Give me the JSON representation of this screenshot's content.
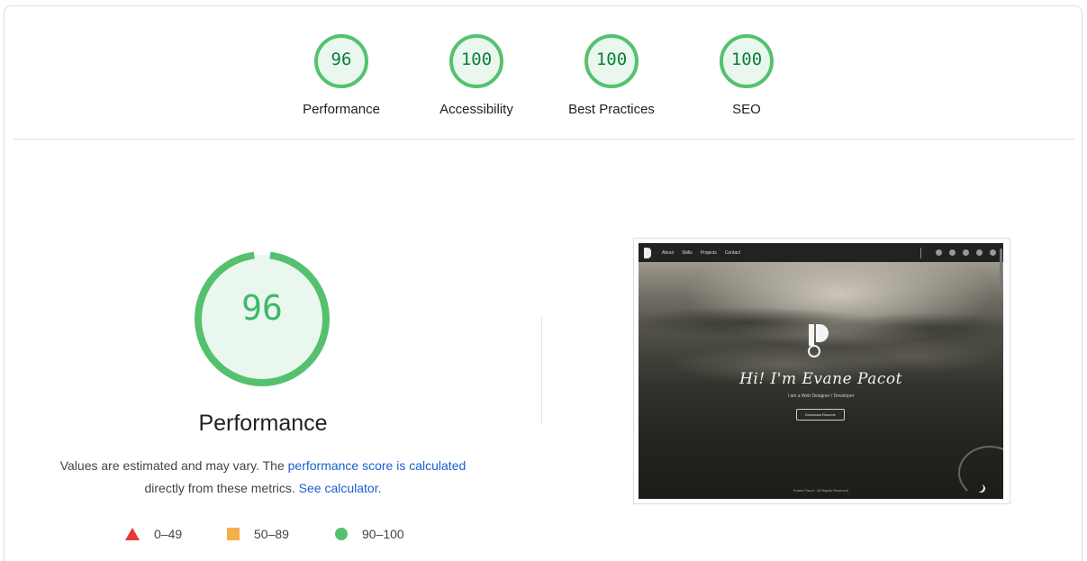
{
  "categories": [
    {
      "score": "96",
      "label": "Performance",
      "fraction": 0.96
    },
    {
      "score": "100",
      "label": "Accessibility",
      "fraction": 1.0
    },
    {
      "score": "100",
      "label": "Best Practices",
      "fraction": 1.0
    },
    {
      "score": "100",
      "label": "SEO",
      "fraction": 1.0
    }
  ],
  "main": {
    "score": "96",
    "fraction": 0.96,
    "title": "Performance",
    "desc_prefix": "Values are estimated and may vary. The ",
    "desc_link1": "performance score is calculated",
    "desc_middle": "directly from these metrics. ",
    "desc_link2": "See calculator",
    "desc_suffix": "."
  },
  "legend": [
    {
      "range": "0–49",
      "shape": "triangle",
      "color": "#e53935"
    },
    {
      "range": "50–89",
      "shape": "square",
      "color": "#f4b048"
    },
    {
      "range": "90–100",
      "shape": "circle",
      "color": "#55c16e"
    }
  ],
  "colors": {
    "pass": "#55c16e",
    "pass_fill": "#eaf7ee",
    "pass_text": "#0b7e3a",
    "link": "#1a5fd0"
  },
  "screenshot": {
    "nav": [
      "About",
      "Skills",
      "Projects",
      "Contact"
    ],
    "hero": "Hi! I'm Evane Pacot",
    "subtitle": "I am a Web Designer / Developer",
    "button": "Download Resume",
    "footer": "Evane Pacot · All Rights Reserved"
  }
}
